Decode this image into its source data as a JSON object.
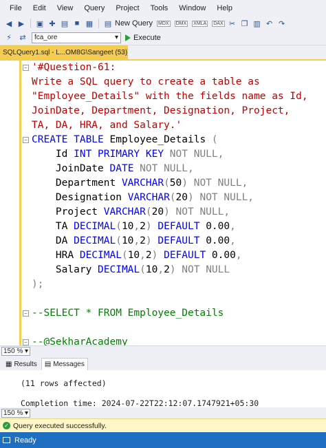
{
  "menu": [
    "File",
    "Edit",
    "View",
    "Query",
    "Project",
    "Tools",
    "Window",
    "Help"
  ],
  "toolbar": {
    "new_query_label": "New Query",
    "mini_icons": [
      "MDX",
      "DMX",
      "XMLA",
      "DAX"
    ]
  },
  "toolbar2": {
    "database": "fca_ore",
    "execute_label": "Execute"
  },
  "document_tab": {
    "title": "SQLQuery1.sql - L...OM8G\\Sangeet (53))*",
    "pin": "⊕",
    "close": "×"
  },
  "editor": {
    "lines": [
      {
        "segments": [
          {
            "t": "'#Question-61:",
            "c": "str"
          }
        ]
      },
      {
        "segments": [
          {
            "t": "Write a SQL query to create a table as",
            "c": "str"
          }
        ]
      },
      {
        "segments": [
          {
            "t": "\"Employee_Details\" with the fields name as Id,",
            "c": "str"
          }
        ]
      },
      {
        "segments": [
          {
            "t": "JoinDate, Department, Designation, Project,",
            "c": "str"
          }
        ]
      },
      {
        "segments": [
          {
            "t": "TA, DA, HRA, and Salary.'",
            "c": "str"
          }
        ]
      },
      {
        "segments": [
          {
            "t": "CREATE TABLE",
            "c": "kw"
          },
          {
            "t": " Employee_Details ",
            "c": "plain"
          },
          {
            "t": "(",
            "c": "gray"
          }
        ]
      },
      {
        "segments": [
          {
            "t": "    Id ",
            "c": "plain"
          },
          {
            "t": "INT PRIMARY KEY",
            "c": "kw"
          },
          {
            "t": " NOT NULL,",
            "c": "gray"
          }
        ]
      },
      {
        "segments": [
          {
            "t": "    JoinDate ",
            "c": "plain"
          },
          {
            "t": "DATE",
            "c": "kw"
          },
          {
            "t": " NOT NULL,",
            "c": "gray"
          }
        ]
      },
      {
        "segments": [
          {
            "t": "    Department ",
            "c": "plain"
          },
          {
            "t": "VARCHAR",
            "c": "kw"
          },
          {
            "t": "(",
            "c": "gray"
          },
          {
            "t": "50",
            "c": "plain"
          },
          {
            "t": ") NOT NULL,",
            "c": "gray"
          }
        ]
      },
      {
        "segments": [
          {
            "t": "    Designation ",
            "c": "plain"
          },
          {
            "t": "VARCHAR",
            "c": "kw"
          },
          {
            "t": "(",
            "c": "gray"
          },
          {
            "t": "20",
            "c": "plain"
          },
          {
            "t": ") NOT NULL,",
            "c": "gray"
          }
        ]
      },
      {
        "segments": [
          {
            "t": "    Project ",
            "c": "plain"
          },
          {
            "t": "VARCHAR",
            "c": "kw"
          },
          {
            "t": "(",
            "c": "gray"
          },
          {
            "t": "20",
            "c": "plain"
          },
          {
            "t": ") NOT NULL,",
            "c": "gray"
          }
        ]
      },
      {
        "segments": [
          {
            "t": "    TA ",
            "c": "plain"
          },
          {
            "t": "DECIMAL",
            "c": "kw"
          },
          {
            "t": "(",
            "c": "gray"
          },
          {
            "t": "10",
            "c": "plain"
          },
          {
            "t": ",",
            "c": "gray"
          },
          {
            "t": "2",
            "c": "plain"
          },
          {
            "t": ") ",
            "c": "gray"
          },
          {
            "t": "DEFAULT",
            "c": "kw"
          },
          {
            "t": " 0.00",
            "c": "plain"
          },
          {
            "t": ",",
            "c": "gray"
          }
        ]
      },
      {
        "segments": [
          {
            "t": "    DA ",
            "c": "plain"
          },
          {
            "t": "DECIMAL",
            "c": "kw"
          },
          {
            "t": "(",
            "c": "gray"
          },
          {
            "t": "10",
            "c": "plain"
          },
          {
            "t": ",",
            "c": "gray"
          },
          {
            "t": "2",
            "c": "plain"
          },
          {
            "t": ") ",
            "c": "gray"
          },
          {
            "t": "DEFAULT",
            "c": "kw"
          },
          {
            "t": " 0.00",
            "c": "plain"
          },
          {
            "t": ",",
            "c": "gray"
          }
        ]
      },
      {
        "segments": [
          {
            "t": "    HRA ",
            "c": "plain"
          },
          {
            "t": "DECIMAL",
            "c": "kw"
          },
          {
            "t": "(",
            "c": "gray"
          },
          {
            "t": "10",
            "c": "plain"
          },
          {
            "t": ",",
            "c": "gray"
          },
          {
            "t": "2",
            "c": "plain"
          },
          {
            "t": ") ",
            "c": "gray"
          },
          {
            "t": "DEFAULT",
            "c": "kw"
          },
          {
            "t": " 0.00",
            "c": "plain"
          },
          {
            "t": ",",
            "c": "gray"
          }
        ]
      },
      {
        "segments": [
          {
            "t": "    Salary ",
            "c": "plain"
          },
          {
            "t": "DECIMAL",
            "c": "kw"
          },
          {
            "t": "(",
            "c": "gray"
          },
          {
            "t": "10",
            "c": "plain"
          },
          {
            "t": ",",
            "c": "gray"
          },
          {
            "t": "2",
            "c": "plain"
          },
          {
            "t": ") NOT NULL",
            "c": "gray"
          }
        ]
      },
      {
        "segments": [
          {
            "t": ");",
            "c": "gray"
          }
        ]
      },
      {
        "segments": [
          {
            "t": "",
            "c": "plain"
          }
        ]
      },
      {
        "segments": [
          {
            "t": "--SELECT * FROM Employee_Details",
            "c": "cm"
          }
        ]
      },
      {
        "segments": [
          {
            "t": "",
            "c": "plain"
          }
        ]
      },
      {
        "segments": [
          {
            "t": "--@SekharAcademy",
            "c": "cm"
          }
        ]
      }
    ]
  },
  "zoom": {
    "editor": "150 %",
    "results": "150 %"
  },
  "results_tabs": {
    "results_label": "Results",
    "messages_label": "Messages"
  },
  "messages": {
    "rows_affected": "(11 rows affected)",
    "completion": "Completion time: 2024-07-22T22:12:07.1747921+05:30"
  },
  "query_status": "Query executed successfully.",
  "status_bar": "Ready",
  "colors": {
    "keyword": "#0000ff",
    "string": "#c00000",
    "comment": "#008000",
    "status_blue": "#1e6fc2",
    "tab_yellow": "#f5cc52"
  }
}
